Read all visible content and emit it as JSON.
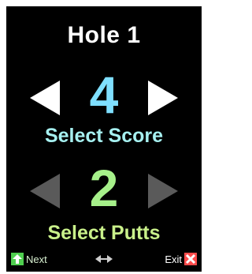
{
  "title": "Hole 1",
  "score": {
    "value": "4",
    "label": "Select Score"
  },
  "putts": {
    "value": "2",
    "label": "Select Putts"
  },
  "footer": {
    "next_label": "Next",
    "exit_label": "Exit",
    "next_icon": "arrow-up-icon",
    "lr_icon": "left-right-arrows-icon",
    "exit_icon": "close-icon"
  },
  "colors": {
    "background": "#000000",
    "score_value": "#7fdfff",
    "score_label": "#a6f0f0",
    "putts_value": "#a6f08a",
    "putts_label": "#c9f08a",
    "active_arrow": "#ffffff",
    "inactive_arrow": "#5a5a5a",
    "next_icon_bg": "#4fcf4f",
    "exit_icon_bg": "#ff4b4b"
  }
}
